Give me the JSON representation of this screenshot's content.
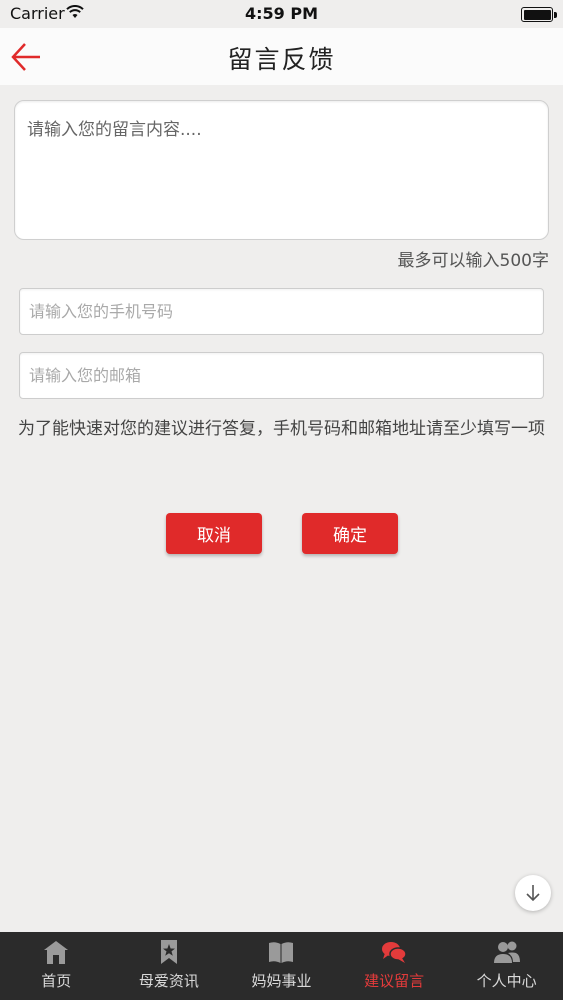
{
  "status_bar": {
    "carrier": "Carrier",
    "time": "4:59 PM"
  },
  "nav": {
    "title": "留言反馈"
  },
  "form": {
    "message_placeholder": "请输入您的留言内容....",
    "char_limit": "最多可以输入500字",
    "phone_placeholder": "请输入您的手机号码",
    "email_placeholder": "请输入您的邮箱",
    "hint": "为了能快速对您的建议进行答复，手机号码和邮箱地址请至少填写一项",
    "cancel_label": "取消",
    "confirm_label": "确定"
  },
  "tabs": [
    {
      "label": "首页",
      "icon": "home-icon"
    },
    {
      "label": "母爱资讯",
      "icon": "bookmark-star-icon"
    },
    {
      "label": "妈妈事业",
      "icon": "book-icon"
    },
    {
      "label": "建议留言",
      "icon": "chat-bubbles-icon",
      "active": true
    },
    {
      "label": "个人中心",
      "icon": "users-icon"
    }
  ],
  "colors": {
    "accent": "#e02a2a",
    "tab_bar": "#2b2b2b",
    "background": "#efeeed"
  }
}
